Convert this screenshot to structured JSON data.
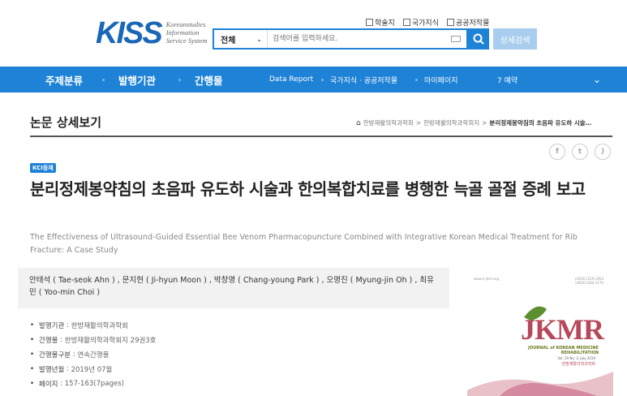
{
  "header": {
    "logo_text": "KISS",
    "logo_sub": [
      "Koreanstudies",
      "Information",
      "Service System"
    ],
    "scope_options": [
      "학술지",
      "국가지식",
      "공공저작물"
    ],
    "search_scope": "전체",
    "search_placeholder": "검색어를 입력하세요.",
    "advanced_search": "상세검색"
  },
  "nav": {
    "main_items": [
      "주제분류",
      "발행기관",
      "간행물"
    ],
    "sub_items": [
      "Data Report",
      "국가지식 · 공공저작물",
      "마이페이지",
      "7 예약"
    ]
  },
  "page": {
    "title": "논문 상세보기",
    "breadcrumb": [
      "한방재활의학과학회",
      "한방재활의학과학회지",
      "분리정제봉약침의 초음파 유도하 시술…"
    ]
  },
  "article": {
    "badge": "KCI등재",
    "title_ko": "분리정제봉약침의 초음파 유도하 시술과 한의복합치료를 병행한 늑골 골절 증례 보고",
    "title_en": "The Effectiveness of Ultrasound-Guided Essential Bee Venom Pharmacopuncture Combined with Integrative Korean Medical Treatment for Rib Fracture: A Case Study",
    "authors": "안태석 ( Tae-seok Ahn ) , 문지현 ( Ji-hyun Moon ) , 박창영 ( Chang-young Park ) , 오명진 ( Myung-jin Oh ) , 최유민 ( Yoo-min Choi )",
    "meta": [
      {
        "key": "발행기관",
        "value": "한방재활의학과학회"
      },
      {
        "key": "간행물",
        "value": "한방재활의학과학회지 29권3호"
      },
      {
        "key": "간행물구분",
        "value": "연속간행물"
      },
      {
        "key": "발행년월",
        "value": "2019년 07월"
      },
      {
        "key": "페이지",
        "value": "157-163(7pages)"
      }
    ]
  },
  "cover": {
    "logo": "JKMR",
    "journal_title": [
      "JOURNAL of KOREAN MEDICINE",
      "REHABILITATION"
    ],
    "volume": "Vol. 29  No. 3, July 2019",
    "society": "한방재활의학과학회"
  },
  "colors": {
    "brand_blue": "#1e82d6",
    "logo_blue": "#1a67b8",
    "cover_red": "#b7485b"
  }
}
